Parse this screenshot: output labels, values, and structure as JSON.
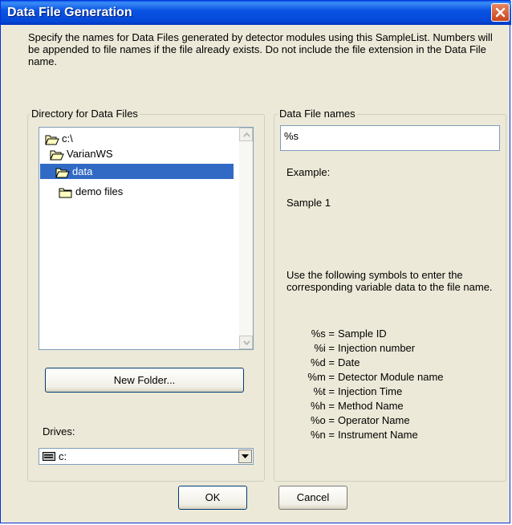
{
  "window": {
    "title": "Data File Generation"
  },
  "description": "Specify the names for Data Files generated by detector modules using this SampleList. Numbers will be appended to file names if the file already exists. Do not include the file extension in the Data File name.",
  "directory_group": {
    "label": "Directory for Data Files",
    "items": [
      {
        "label": "c:\\",
        "icon": "open-folder-icon",
        "selected": false
      },
      {
        "label": "VarianWS",
        "icon": "open-folder-icon",
        "selected": false
      },
      {
        "label": "data",
        "icon": "open-folder-icon",
        "selected": true
      },
      {
        "label": "demo files",
        "icon": "folder-icon",
        "selected": false
      }
    ],
    "new_folder_button": "New Folder...",
    "drives_label": "Drives:",
    "drives_value": "c:"
  },
  "names_group": {
    "label": "Data File names",
    "input_value": "%s",
    "example_label": "Example:",
    "example_value": "Sample 1",
    "instructions": "Use the following symbols to enter the corresponding variable data to the file name.",
    "symbols": [
      {
        "key": "%s =",
        "desc": "Sample ID"
      },
      {
        "key": "%i =",
        "desc": "Injection number"
      },
      {
        "key": "%d =",
        "desc": "Date"
      },
      {
        "key": "%m =",
        "desc": "Detector Module name"
      },
      {
        "key": "%t =",
        "desc": "Injection Time"
      },
      {
        "key": "%h =",
        "desc": "Method Name"
      },
      {
        "key": "%o =",
        "desc": "Operator Name"
      },
      {
        "key": "%n =",
        "desc": "Instrument Name"
      }
    ]
  },
  "buttons": {
    "ok": "OK",
    "cancel": "Cancel"
  },
  "colors": {
    "titlebar": "#0548d8",
    "selection": "#316ac5",
    "dialog_bg": "#ece9d8",
    "close_button": "#c9441a"
  }
}
